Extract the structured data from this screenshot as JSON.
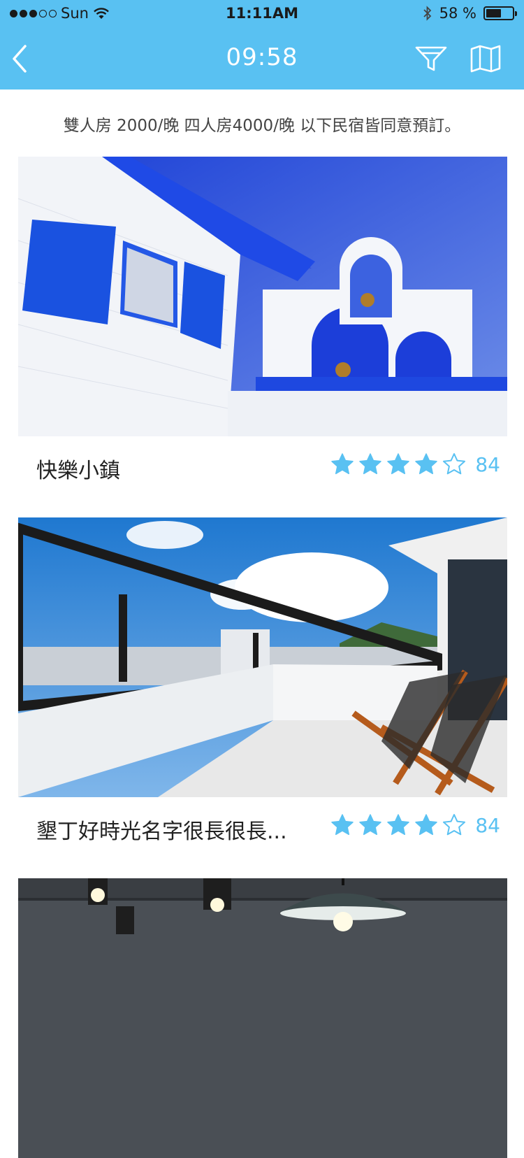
{
  "status_bar": {
    "signal_full": 3,
    "signal_empty": 2,
    "carrier": "Sun",
    "time": "11:11AM",
    "battery": "58 %",
    "battery_fraction": 0.58,
    "icons": [
      "wifi-icon",
      "bluetooth-icon",
      "battery-icon"
    ]
  },
  "nav": {
    "title": "09:58",
    "icons": [
      "back-chevron-icon",
      "filter-funnel-icon",
      "map-icon"
    ],
    "bg_color": "#59c1f2"
  },
  "notice": "雙人房 2000/晚 四人房4000/晚 以下民宿皆同意預訂。",
  "listings": [
    {
      "name": "快樂小鎮",
      "rating": 4,
      "rating_max": 5,
      "review_count": "84",
      "photo": "white-blue-bell-tower-building"
    },
    {
      "name": "墾丁好時光名字很長很長...",
      "rating": 4,
      "rating_max": 5,
      "review_count": "84",
      "photo": "rooftop-terrace-lounge-chairs"
    },
    {
      "photo": "interior-pendant-lamps"
    }
  ],
  "colors": {
    "accent": "#59c1f2",
    "star": "#59c1f2"
  }
}
